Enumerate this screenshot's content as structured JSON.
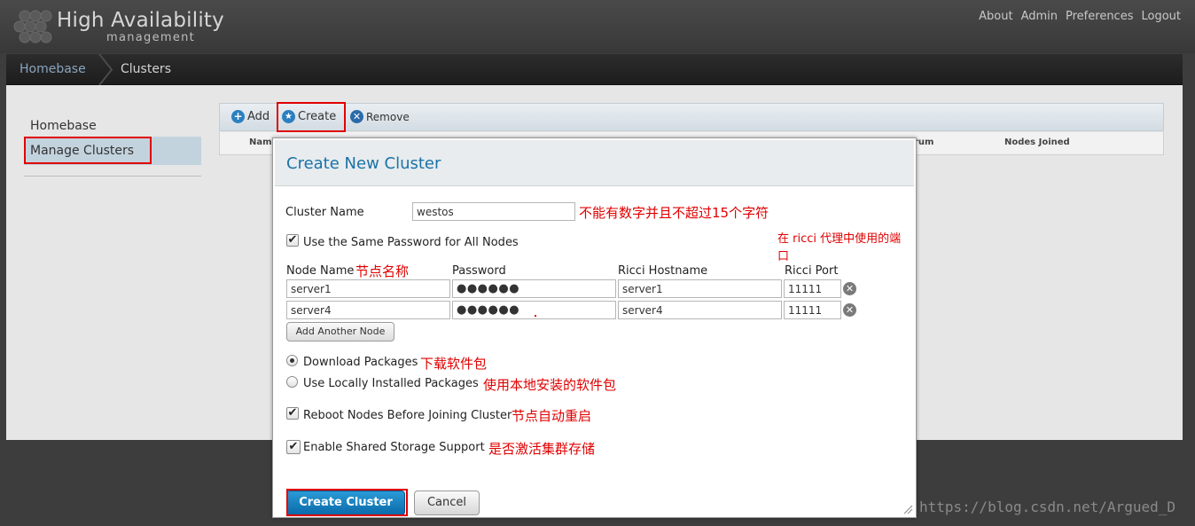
{
  "app": {
    "title": "High Availability",
    "subtitle": "management"
  },
  "top_links": [
    "About",
    "Admin",
    "Preferences",
    "Logout"
  ],
  "breadcrumb": {
    "home": "Homebase",
    "current": "Clusters"
  },
  "sidebar": {
    "items": [
      {
        "label": "Homebase"
      },
      {
        "label": "Manage Clusters"
      }
    ]
  },
  "toolbar": {
    "add": "Add",
    "create": "Create",
    "remove": "Remove"
  },
  "table_headers": {
    "name": "Nam",
    "quorum": "rum",
    "nodes_joined": "Nodes Joined"
  },
  "modal": {
    "title": "Create New Cluster",
    "cluster_name_label": "Cluster Name",
    "cluster_name_value": "westos",
    "cluster_name_note": "不能有数字并且不超过15个字符",
    "same_password_label": "Use the Same Password for All Nodes",
    "ricci_port_note": "在 ricci 代理中使用的端口",
    "columns": {
      "node_name": "Node Name",
      "password": "Password",
      "ricci_hostname": "Ricci Hostname",
      "ricci_port": "Ricci Port"
    },
    "node_name_note": "节点名称",
    "nodes": [
      {
        "name": "server1",
        "password": "●●●●●●",
        "hostname": "server1",
        "port": "11111"
      },
      {
        "name": "server4",
        "password": "●●●●●●",
        "hostname": "server4",
        "port": "11111"
      }
    ],
    "add_node": "Add Another Node",
    "download_label": "Download Packages",
    "download_note": "下载软件包",
    "local_label": "Use Locally Installed Packages",
    "local_note": "使用本地安装的软件包",
    "reboot_label": "Reboot Nodes Before Joining Cluster",
    "reboot_note": "节点自动重启",
    "shared_label": "Enable Shared Storage Support",
    "shared_note": "是否激活集群存储",
    "create_button": "Create Cluster",
    "cancel_button": "Cancel"
  },
  "checkmark_glyph": "✔",
  "watermark": "https://blog.csdn.net/Argued_D",
  "colors": {
    "accent": "#1b72a6",
    "annotation": "#e00000",
    "primary_button": "#0a6aaa"
  }
}
